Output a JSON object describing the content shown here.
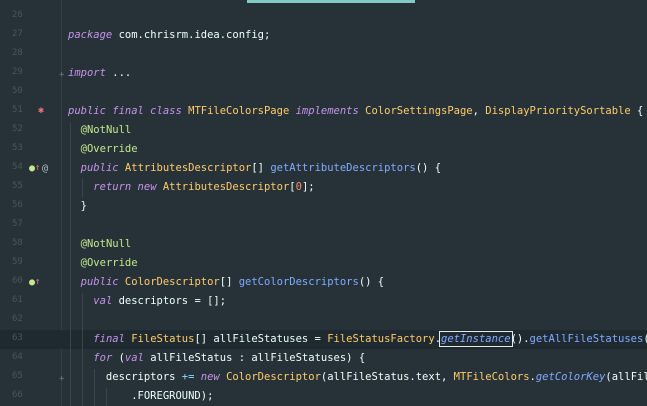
{
  "lines": [
    {
      "n": "26",
      "t": []
    },
    {
      "n": "27",
      "t": [
        {
          "c": "kw",
          "v": "package"
        },
        {
          "c": "pl",
          "v": " com.chrisrm.idea.config;"
        }
      ]
    },
    {
      "n": "28",
      "t": []
    },
    {
      "n": "29",
      "t": [
        {
          "c": "kw",
          "v": "import"
        },
        {
          "c": "pl",
          "v": " ..."
        }
      ]
    },
    {
      "n": "50",
      "t": []
    },
    {
      "n": "51",
      "t": [
        {
          "c": "kw",
          "v": "public final class"
        },
        {
          "c": "pl",
          "v": " "
        },
        {
          "c": "ty",
          "v": "MTFileColorsPage"
        },
        {
          "c": "pl",
          "v": " "
        },
        {
          "c": "kw",
          "v": "implements"
        },
        {
          "c": "pl",
          "v": " "
        },
        {
          "c": "ty",
          "v": "ColorSettingsPage"
        },
        {
          "c": "pl",
          "v": ", "
        },
        {
          "c": "ty",
          "v": "DisplayPrioritySortable"
        },
        {
          "c": "pl",
          "v": " {"
        }
      ]
    },
    {
      "n": "52",
      "t": [
        {
          "c": "pl",
          "v": "  "
        },
        {
          "c": "ann",
          "v": "@NotNull"
        }
      ]
    },
    {
      "n": "53",
      "t": [
        {
          "c": "pl",
          "v": "  "
        },
        {
          "c": "ann",
          "v": "@Override"
        }
      ]
    },
    {
      "n": "54",
      "t": [
        {
          "c": "pl",
          "v": "  "
        },
        {
          "c": "kw",
          "v": "public"
        },
        {
          "c": "pl",
          "v": " "
        },
        {
          "c": "ty",
          "v": "AttributesDescriptor"
        },
        {
          "c": "pl",
          "v": "[] "
        },
        {
          "c": "fn",
          "v": "getAttributeDescriptors"
        },
        {
          "c": "pl",
          "v": "() {"
        }
      ]
    },
    {
      "n": "55",
      "t": [
        {
          "c": "pl",
          "v": "    "
        },
        {
          "c": "kw",
          "v": "return new"
        },
        {
          "c": "pl",
          "v": " "
        },
        {
          "c": "ty",
          "v": "AttributesDescriptor"
        },
        {
          "c": "pl",
          "v": "["
        },
        {
          "c": "num",
          "v": "0"
        },
        {
          "c": "pl",
          "v": "];"
        }
      ]
    },
    {
      "n": "56",
      "t": [
        {
          "c": "pl",
          "v": "  }"
        }
      ]
    },
    {
      "n": "57",
      "t": []
    },
    {
      "n": "58",
      "t": [
        {
          "c": "pl",
          "v": "  "
        },
        {
          "c": "ann",
          "v": "@NotNull"
        }
      ]
    },
    {
      "n": "59",
      "t": [
        {
          "c": "pl",
          "v": "  "
        },
        {
          "c": "ann",
          "v": "@Override"
        }
      ]
    },
    {
      "n": "60",
      "t": [
        {
          "c": "pl",
          "v": "  "
        },
        {
          "c": "kw",
          "v": "public"
        },
        {
          "c": "pl",
          "v": " "
        },
        {
          "c": "ty",
          "v": "ColorDescriptor"
        },
        {
          "c": "pl",
          "v": "[] "
        },
        {
          "c": "fn",
          "v": "getColorDescriptors"
        },
        {
          "c": "pl",
          "v": "() {"
        }
      ]
    },
    {
      "n": "61",
      "t": [
        {
          "c": "pl",
          "v": "    "
        },
        {
          "c": "kw",
          "v": "val"
        },
        {
          "c": "pl",
          "v": " descriptors = [];"
        }
      ]
    },
    {
      "n": "62",
      "t": []
    },
    {
      "n": "63",
      "t": [
        {
          "c": "pl",
          "v": "    "
        },
        {
          "c": "kw",
          "v": "final"
        },
        {
          "c": "pl",
          "v": " "
        },
        {
          "c": "ty",
          "v": "FileStatus"
        },
        {
          "c": "pl",
          "v": "[] allFileStatuses = "
        },
        {
          "c": "ty",
          "v": "FileStatusFactory"
        },
        {
          "c": "pl",
          "v": "."
        },
        {
          "c": "stat",
          "v": "getInstance",
          "box": true
        },
        {
          "c": "pl",
          "v": "()."
        },
        {
          "c": "fn",
          "v": "getAllFileStatuses"
        },
        {
          "c": "pl",
          "v": "();"
        }
      ],
      "current": true
    },
    {
      "n": "64",
      "t": [
        {
          "c": "pl",
          "v": "    "
        },
        {
          "c": "kw",
          "v": "for"
        },
        {
          "c": "pl",
          "v": " ("
        },
        {
          "c": "kw",
          "v": "val"
        },
        {
          "c": "pl",
          "v": " allFileStatus : allFileStatuses) {"
        }
      ]
    },
    {
      "n": "65",
      "t": [
        {
          "c": "pl",
          "v": "      descriptors "
        },
        {
          "c": "pn",
          "v": "+="
        },
        {
          "c": "pl",
          "v": " "
        },
        {
          "c": "kw",
          "v": "new"
        },
        {
          "c": "pl",
          "v": " "
        },
        {
          "c": "ty",
          "v": "ColorDescriptor"
        },
        {
          "c": "pl",
          "v": "(allFileStatus.text, "
        },
        {
          "c": "ty",
          "v": "MTFileColors"
        },
        {
          "c": "pl",
          "v": "."
        },
        {
          "c": "stat",
          "v": "getColorKey"
        },
        {
          "c": "pl",
          "v": "(allFileStatus),"
        }
      ]
    },
    {
      "n": "66",
      "t": [
        {
          "c": "pl",
          "v": "          .FOREGROUND);"
        }
      ]
    }
  ]
}
